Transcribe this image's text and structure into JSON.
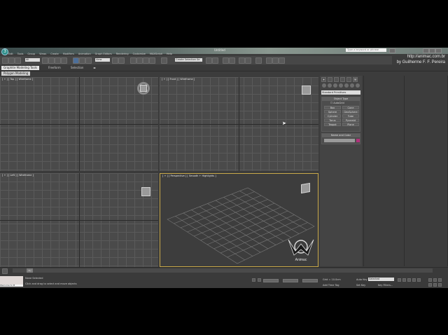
{
  "window": {
    "title": "Untitled",
    "logo": "3ds-max-logo"
  },
  "search": {
    "placeholder": "Type a keyword or phrase"
  },
  "watermark": {
    "line1": "http://animac.com.br",
    "line2": "by Guilherme F. F. Pereira"
  },
  "menu": [
    "Edit",
    "Tools",
    "Group",
    "Views",
    "Create",
    "Modifiers",
    "Animation",
    "Graph Editors",
    "Rendering",
    "Customize",
    "MAXScript",
    "Help"
  ],
  "toolbar": {
    "selection_filter": "All",
    "view_dropdown": "View",
    "selection_set": "Create Selection Se"
  },
  "ribbon": {
    "tabs": [
      "Graphite Modeling Tools",
      "Freeform",
      "Selection"
    ],
    "active": "Graphite Modeling Tools",
    "sub_label": "Polygon Modeling"
  },
  "viewports": {
    "top": "[ + ] [ Top ] [ Wireframe ]",
    "front": "[ + ] [ Front ] [ Wireframe ]",
    "left": "[ + ] [ Left ] [ Wireframe ]",
    "perspective": "[ + ] [ Perspective ] [ Smooth + Highlights ]",
    "logo_text": "Animac"
  },
  "command_panel": {
    "category_dropdown": "Standard Primitives",
    "object_type": {
      "header": "Object Type",
      "autogrid": "AutoGrid",
      "buttons": [
        "Box",
        "Cone",
        "Sphere",
        "GeoSphere",
        "Cylinder",
        "Tube",
        "Torus",
        "Pyramid",
        "Teapot",
        "Plane"
      ]
    },
    "name_color": {
      "header": "Name and Color",
      "swatch": "#b0307a"
    }
  },
  "timeline": {
    "frame_display": "0 / 100"
  },
  "status": {
    "maxscript_listener": "Welcome to M",
    "selection": "None Selected",
    "prompt": "Click and drag to select and move objects",
    "grid": "Grid = 10.0cm",
    "auto_key": "Auto Key",
    "set_key": "Set Key",
    "selected_dropdown": "Selected",
    "key_filters": "Key Filters...",
    "add_time_tag": "Add Time Tag"
  }
}
